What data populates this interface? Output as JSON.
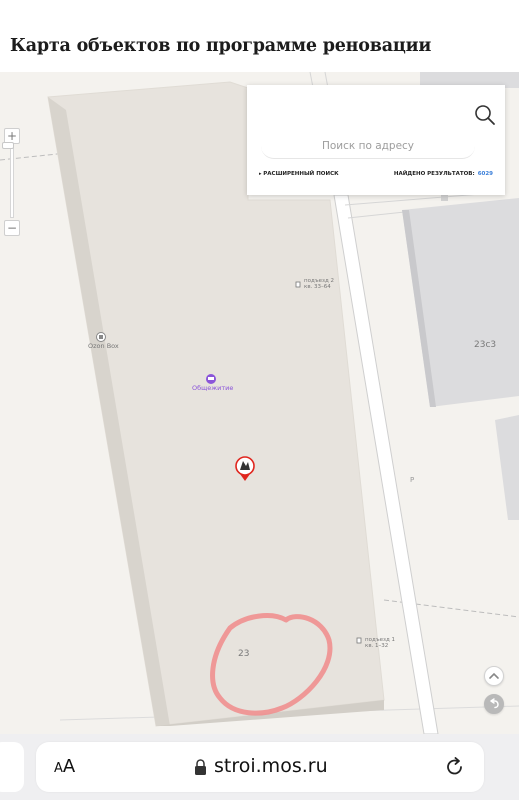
{
  "page": {
    "title": "Карта объектов по программе реновации"
  },
  "search": {
    "placeholder": "Поиск по адресу",
    "advanced_label": "РАСШИРЕННЫЙ ПОИСК",
    "results_label": "НАЙДЕНО РЕЗУЛЬТАТОВ:",
    "results_count": "6029"
  },
  "map": {
    "zoom_in": "+",
    "zoom_out": "−",
    "labels": {
      "poi_ozon": "Ozon Box",
      "poi_dorm": "Общежитие",
      "entrance2_line1": "подъезд 2",
      "entrance2_line2": "кв. 33–64",
      "entrance1_line1": "подъезд 1",
      "entrance1_line2": "кв. 1–32",
      "building_23c3": "23с3",
      "building_23": "23",
      "parking": "P"
    },
    "icons": {
      "search": "search-icon",
      "location_up": "chevron-up-icon",
      "back": "undo-icon",
      "marker": "renovation-marker-icon",
      "dorm": "bed-icon",
      "ozon": "package-icon",
      "entrance": "door-icon"
    },
    "colors": {
      "background": "#f4f2ee",
      "building_main": "#e7e3dd",
      "building_grey": "#dcdcde",
      "annotation": "#f08f8f",
      "poi_purple": "#8b55d9",
      "marker_red": "#e0261e",
      "accent_blue": "#3b7fd9"
    }
  },
  "browser": {
    "text_size_small": "A",
    "text_size_big": "A",
    "url": "stroi.mos.ru"
  }
}
